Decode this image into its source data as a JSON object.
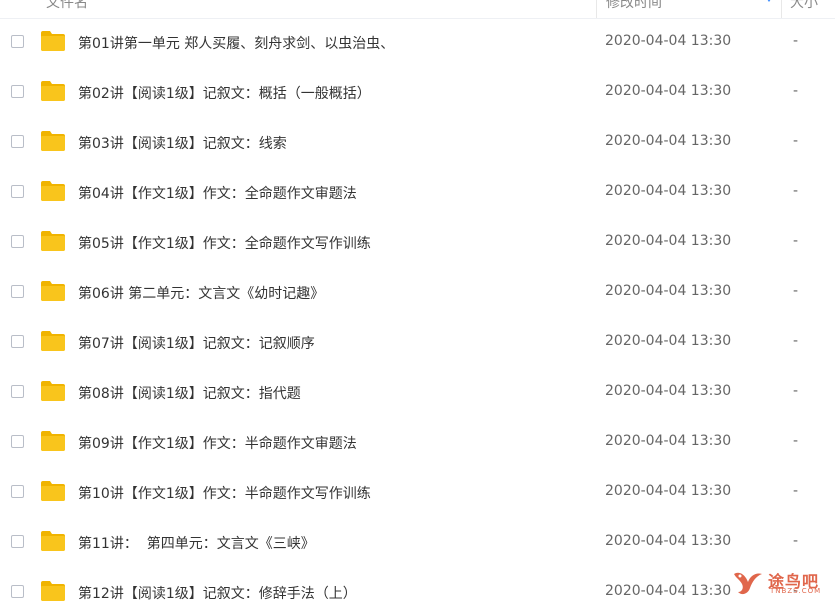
{
  "header": {
    "name_label": "文件名",
    "time_label": "修改时间",
    "size_label": "大小"
  },
  "files": [
    {
      "name": "第01讲第一单元 郑人买履、刻舟求剑、以虫治虫、",
      "modified": "2020-04-04 13:30",
      "size": "-"
    },
    {
      "name": "第02讲【阅读1级】记叙文：概括（一般概括）",
      "modified": "2020-04-04 13:30",
      "size": "-"
    },
    {
      "name": "第03讲【阅读1级】记叙文：线索",
      "modified": "2020-04-04 13:30",
      "size": "-"
    },
    {
      "name": "第04讲【作文1级】作文：全命题作文审题法",
      "modified": "2020-04-04 13:30",
      "size": "-"
    },
    {
      "name": "第05讲【作文1级】作文：全命题作文写作训练",
      "modified": "2020-04-04 13:30",
      "size": "-"
    },
    {
      "name": "第06讲 第二单元：文言文《幼时记趣》",
      "modified": "2020-04-04 13:30",
      "size": "-"
    },
    {
      "name": "第07讲【阅读1级】记叙文：记叙顺序",
      "modified": "2020-04-04 13:30",
      "size": "-"
    },
    {
      "name": "第08讲【阅读1级】记叙文：指代题",
      "modified": "2020-04-04 13:30",
      "size": "-"
    },
    {
      "name": "第09讲【作文1级】作文：半命题作文审题法",
      "modified": "2020-04-04 13:30",
      "size": "-"
    },
    {
      "name": "第10讲【作文1级】作文：半命题作文写作训练",
      "modified": "2020-04-04 13:30",
      "size": "-"
    },
    {
      "name": "第11讲：  第四单元：文言文《三峡》",
      "modified": "2020-04-04 13:30",
      "size": "-"
    },
    {
      "name": "第12讲【阅读1级】记叙文：修辞手法（上）",
      "modified": "2020-04-04 13:30",
      "size": "-"
    }
  ],
  "watermark": {
    "text": "途鸟吧",
    "url": "TNBZS.COM"
  },
  "colors": {
    "folder": "#f9c51c",
    "folder_back": "#f0b400",
    "watermark": "#e0664b"
  }
}
